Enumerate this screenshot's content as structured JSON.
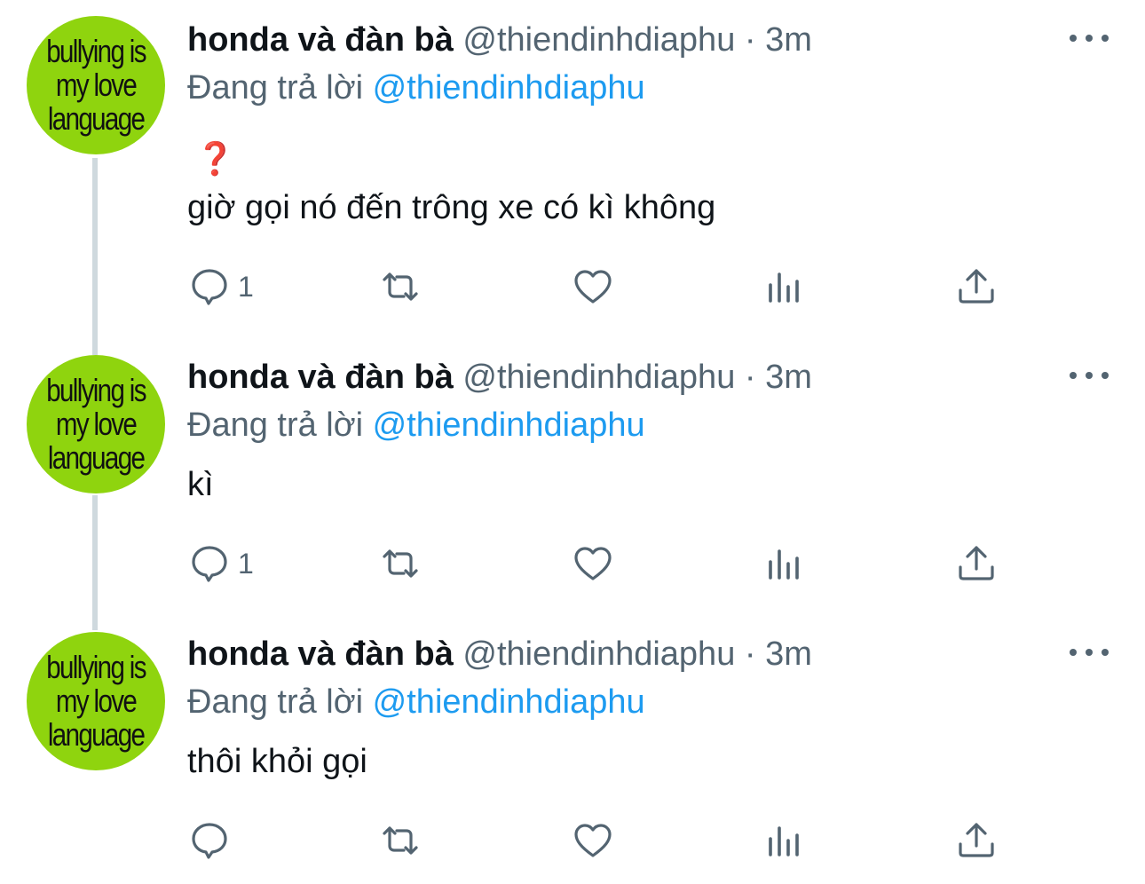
{
  "colors": {
    "text": "#0f1419",
    "secondary": "#536471",
    "link": "#1d9bf0",
    "avatar_bg": "#8fd40e",
    "thread_line": "#cfd9de"
  },
  "avatar_text": [
    "bullying is",
    "my love",
    "language"
  ],
  "tweets": [
    {
      "name": "honda và đàn bà",
      "handle": "@thiendinhdiaphu",
      "separator": "·",
      "time": "3m",
      "reply_prefix": "Đang trả lời",
      "reply_to": "@thiendinhdiaphu",
      "emoji": "❓",
      "text": "giờ gọi nó đến trông xe có kì không",
      "reply_count": "1"
    },
    {
      "name": "honda và đàn bà",
      "handle": "@thiendinhdiaphu",
      "separator": "·",
      "time": "3m",
      "reply_prefix": "Đang trả lời",
      "reply_to": "@thiendinhdiaphu",
      "text": "kì",
      "reply_count": "1"
    },
    {
      "name": "honda và đàn bà",
      "handle": "@thiendinhdiaphu",
      "separator": "·",
      "time": "3m",
      "reply_prefix": "Đang trả lời",
      "reply_to": "@thiendinhdiaphu",
      "text": "thôi khỏi gọi",
      "reply_count": ""
    }
  ],
  "icons": {
    "more": "more-horizontal-icon",
    "reply": "reply-bubble-icon",
    "retweet": "retweet-icon",
    "like": "heart-icon",
    "views": "bar-chart-icon",
    "share": "share-upload-icon"
  }
}
